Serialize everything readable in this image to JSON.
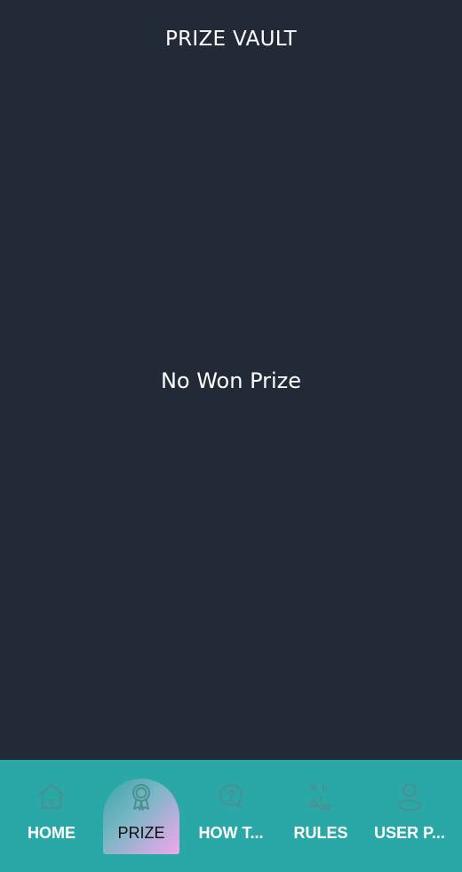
{
  "header": {
    "title": "PRIZE VAULT"
  },
  "main": {
    "empty_message": "No Won Prize"
  },
  "bottom_nav": {
    "active_index": 1,
    "items": [
      {
        "label": "HOME",
        "icon": "home-icon"
      },
      {
        "label": "PRIZE",
        "icon": "award-icon"
      },
      {
        "label": "HOW T...",
        "icon": "help-bubble-icon"
      },
      {
        "label": "RULES",
        "icon": "rules-shapes-icon"
      },
      {
        "label": "USER P...",
        "icon": "user-icon"
      }
    ]
  },
  "colors": {
    "background": "#222937",
    "nav_background": "#2aa8a8",
    "icon_color": "#4b8f91",
    "text": "#ffffff",
    "active_gradient_start": "#3aa5a8",
    "active_gradient_end": "#f4a6ee"
  }
}
